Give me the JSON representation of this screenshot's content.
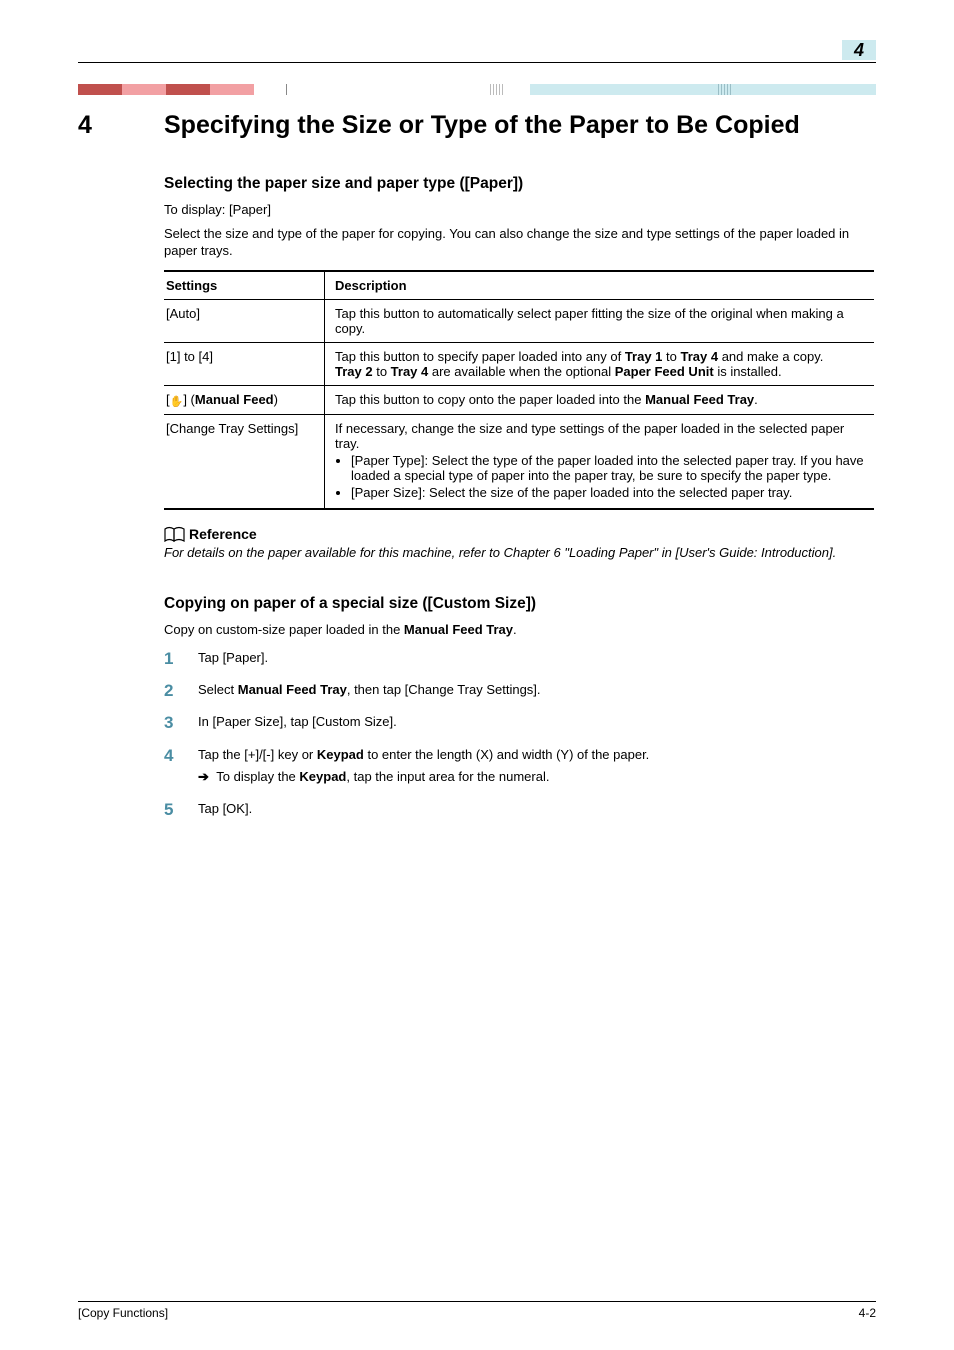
{
  "chapter_indicator": "4",
  "chapter_num": "4",
  "chapter_title": "Specifying the Size or Type of the Paper to Be Copied",
  "section1": {
    "heading": "Selecting the paper size and paper type ([Paper])",
    "display_path": "To display: [Paper]",
    "intro": "Select the size and type of the paper for copying. You can also change the size and type settings of the paper loaded in paper trays."
  },
  "table": {
    "head_settings": "Settings",
    "head_description": "Description",
    "rows": [
      {
        "setting": "[Auto]",
        "desc_plain": "Tap this button to automatically select paper fitting the size of the original when making a copy."
      },
      {
        "setting": "[1] to [4]",
        "desc_line1_pre": "Tap this button to specify paper loaded into any of ",
        "desc_line1_b1": "Tray 1",
        "desc_line1_mid": " to ",
        "desc_line1_b2": "Tray 4",
        "desc_line1_post": " and make a copy.",
        "desc_line2_b1": "Tray 2",
        "desc_line2_mid": " to ",
        "desc_line2_b2": "Tray 4",
        "desc_line2_post": " are available when the optional ",
        "desc_line2_b3": "Paper Feed Unit",
        "desc_line2_end": " is installed."
      },
      {
        "setting_pre": "[",
        "setting_icon": "hand",
        "setting_post": "] (",
        "setting_bold": "Manual Feed",
        "setting_close": ")",
        "desc_pre": "Tap this button to copy onto the paper loaded into the ",
        "desc_bold": "Manual Feed Tray",
        "desc_post": "."
      },
      {
        "setting": "[Change Tray Settings]",
        "desc_intro": "If necessary, change the size and type settings of the paper loaded in the selected paper tray.",
        "bullet1": "[Paper Type]: Select the type of the paper loaded into the selected paper tray. If you have loaded a special type of paper into the paper tray, be sure to specify the paper type.",
        "bullet2": "[Paper Size]: Select the size of the paper loaded into the selected paper tray."
      }
    ]
  },
  "reference_label": "Reference",
  "reference_text": "For details on the paper available for this machine, refer to Chapter 6 \"Loading Paper\" in [User's Guide: Introduction].",
  "section2": {
    "heading": "Copying on paper of a special size ([Custom Size])",
    "intro_pre": "Copy on custom-size paper loaded in the ",
    "intro_bold": "Manual Feed Tray",
    "intro_post": "."
  },
  "steps": {
    "s1": "Tap [Paper].",
    "s2_pre": "Select ",
    "s2_bold": "Manual Feed Tray",
    "s2_post": ", then tap [Change Tray Settings].",
    "s3": "In [Paper Size], tap [Custom Size].",
    "s4_pre": "Tap the [+]/[-] key or ",
    "s4_bold": "Keypad",
    "s4_post": " to enter the length (X) and width (Y) of the paper.",
    "s4_sub_pre": "To display the ",
    "s4_sub_bold": "Keypad",
    "s4_sub_post": ", tap the input area for the numeral.",
    "s5": "Tap [OK]."
  },
  "footer_left": "[Copy Functions]",
  "footer_right": "4-2"
}
